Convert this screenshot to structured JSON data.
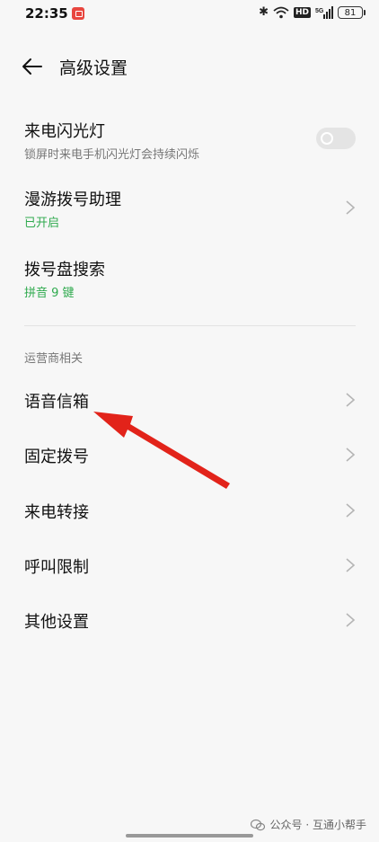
{
  "status_bar": {
    "time": "22:35",
    "hd": "HD",
    "signal": "5G",
    "battery": "81"
  },
  "header": {
    "title": "高级设置"
  },
  "items": [
    {
      "title": "来电闪光灯",
      "subtitle": "锁屏时来电手机闪光灯会持续闪烁",
      "control": "toggle",
      "toggle_on": false
    },
    {
      "title": "漫游拨号助理",
      "subtitle": "已开启",
      "control": "chevron"
    },
    {
      "title": "拨号盘搜索",
      "subtitle": "拼音 9 键",
      "control": "none"
    }
  ],
  "section": {
    "label": "运营商相关",
    "items": [
      {
        "title": "语音信箱"
      },
      {
        "title": "固定拨号"
      },
      {
        "title": "来电转接"
      },
      {
        "title": "呼叫限制"
      },
      {
        "title": "其他设置"
      }
    ]
  },
  "watermark": {
    "text": "公众号 · 互通小帮手"
  },
  "colors": {
    "accent_green": "#2faa4e",
    "annotation_red": "#e2231a",
    "background": "#f7f7f7"
  }
}
